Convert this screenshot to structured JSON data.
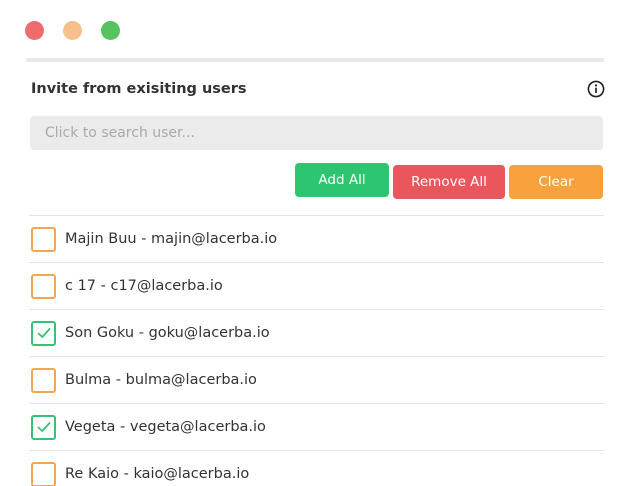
{
  "window": {
    "controls": [
      "close-button",
      "minimize-button",
      "maximize-button"
    ]
  },
  "header": {
    "title": "Invite from exisiting users",
    "info_icon": "info-icon"
  },
  "search": {
    "placeholder": "Click to search user...",
    "value": ""
  },
  "actions": {
    "add_all": "Add All",
    "remove_all": "Remove All",
    "clear": "Clear"
  },
  "colors": {
    "add": "#2dc570",
    "remove": "#e9575c",
    "clear": "#f8a13d",
    "checked_border": "#35c274",
    "unchecked_border": "#f3a552"
  },
  "users": [
    {
      "label": "Majin Buu - majin@lacerba.io",
      "checked": false
    },
    {
      "label": "c 17 - c17@lacerba.io",
      "checked": false
    },
    {
      "label": "Son Goku - goku@lacerba.io",
      "checked": true
    },
    {
      "label": "Bulma - bulma@lacerba.io",
      "checked": false
    },
    {
      "label": "Vegeta - vegeta@lacerba.io",
      "checked": true
    },
    {
      "label": "Re Kaio - kaio@lacerba.io",
      "checked": false
    }
  ]
}
